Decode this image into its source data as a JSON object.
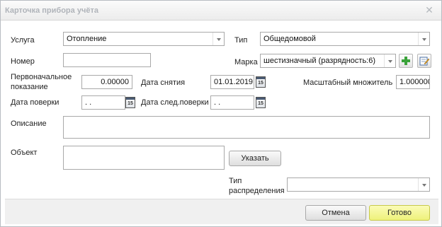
{
  "window": {
    "title": "Карточка прибора учёта",
    "close_glyph": "✕"
  },
  "form": {
    "service": {
      "label": "Услуга",
      "value": "Отопление"
    },
    "type": {
      "label": "Тип",
      "value": "Общедомовой"
    },
    "number": {
      "label": "Номер",
      "value": ""
    },
    "brand": {
      "label": "Марка",
      "value": "шестизначный (разрядность:6)"
    },
    "initial_reading": {
      "label": "Первоначальное показание",
      "value": "0.00000"
    },
    "removal_date": {
      "label": "Дата снятия",
      "value": "01.01.2019"
    },
    "scale_factor": {
      "label": "Масштабный множитель",
      "value": "1.000000"
    },
    "verification_date": {
      "label": "Дата поверки",
      "value": " .  . "
    },
    "next_verification_date": {
      "label": "Дата след.поверки",
      "value": " .  . "
    },
    "description": {
      "label": "Описание",
      "value": ""
    },
    "object": {
      "label": "Объект",
      "value": ""
    },
    "specify_button": "Указать",
    "distribution_type": {
      "label": "Тип распределения",
      "value": ""
    },
    "calendar_glyph": "15"
  },
  "footer": {
    "cancel_label": "Отмена",
    "done_label": "Готово"
  },
  "icons": {
    "add": "add-icon",
    "edit": "edit-icon",
    "calendar": "calendar-icon",
    "dropdown": "chevron-down-icon"
  },
  "colors": {
    "primary_button": "#eef17a",
    "add_icon": "#3aa23a"
  }
}
